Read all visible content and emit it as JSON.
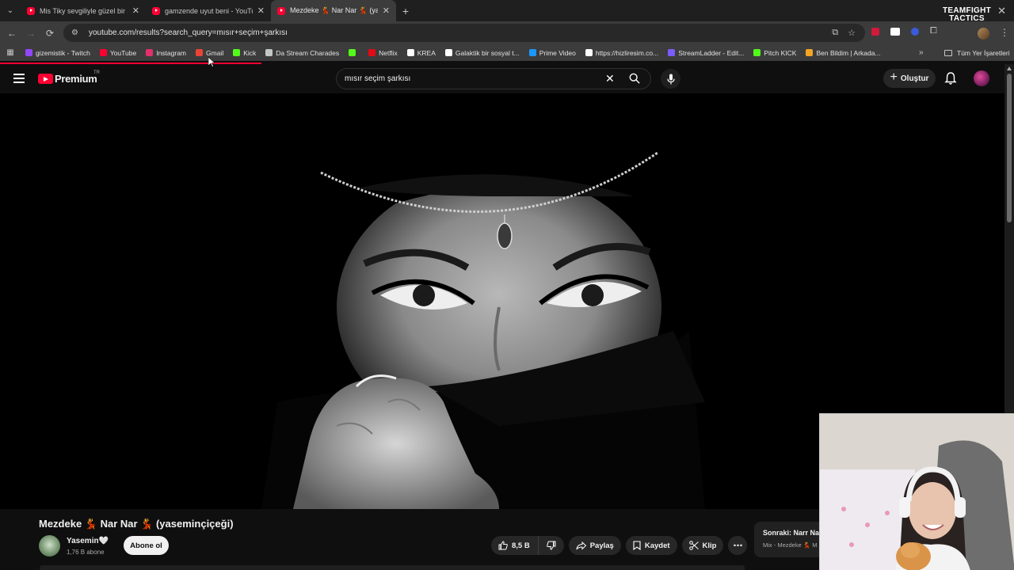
{
  "browser": {
    "tabs": [
      {
        "title": "Mis Tiky sevgiliyle güzel bir ara",
        "active": false
      },
      {
        "title": "gamzende uyut beni - YouTube",
        "active": false
      },
      {
        "title": "Mezdeke 💃 Nar Nar 💃 (yase",
        "active": true
      }
    ],
    "corner_logo": {
      "line1": "TEAMFIGHT",
      "line2": "TACTICS"
    },
    "url": "youtube.com/results?search_query=mısır+seçim+şarkısı",
    "bookmarks": [
      {
        "label": "gizemistik - Twitch",
        "icon": "twitch-icon",
        "color": "#9146ff"
      },
      {
        "label": "YouTube",
        "icon": "youtube-icon",
        "color": "#ff0033"
      },
      {
        "label": "Instagram",
        "icon": "instagram-icon",
        "color": "#e1306c"
      },
      {
        "label": "Gmail",
        "icon": "gmail-icon",
        "color": "#ea4335"
      },
      {
        "label": "Kick",
        "icon": "kick-icon",
        "color": "#53fc18"
      },
      {
        "label": "Da Stream Charades",
        "icon": "puzzle-icon",
        "color": "#c4c7c5"
      },
      {
        "label": "",
        "icon": "kick-icon",
        "color": "#53fc18"
      },
      {
        "label": "Netflix",
        "icon": "netflix-icon",
        "color": "#e50914"
      },
      {
        "label": "KREA",
        "icon": "krea-icon",
        "color": "#ffffff"
      },
      {
        "label": "Galaktik bir sosyal t...",
        "icon": "zk-icon",
        "color": "#ffffff"
      },
      {
        "label": "Prime Video",
        "icon": "prime-video-icon",
        "color": "#1a98ff"
      },
      {
        "label": "https://hizliresim.co...",
        "icon": "hizliresim-icon",
        "color": "#ffffff"
      },
      {
        "label": "StreamLadder - Edit...",
        "icon": "streamladder-icon",
        "color": "#7b5cff"
      },
      {
        "label": "Pitch KICK",
        "icon": "kick-icon",
        "color": "#53fc18"
      },
      {
        "label": "Ben Bildim | Arkada...",
        "icon": "benbildim-icon",
        "color": "#f4a623"
      }
    ],
    "all_bookmarks_label": "Tüm Yer İşaretleri"
  },
  "youtube": {
    "logo_text": "Premium",
    "logo_region": "TR",
    "search_value": "mısır seçim şarkısı",
    "create_label": "Oluştur",
    "video": {
      "title": "Mezdeke 💃 Nar Nar 💃 (yaseminçiçeği)",
      "channel": "Yasemin🤍",
      "subscribers": "1,76 B abone",
      "subscribe_label": "Abone ol",
      "likes": "8,5 B",
      "share_label": "Paylaş",
      "save_label": "Kaydet",
      "clip_label": "Klip"
    },
    "next_up": {
      "label": "Sonraki: Narr Narr",
      "sub": "Mix - Mezdeke 💃 M"
    }
  },
  "colors": {
    "accent": "#ff0033",
    "background": "#0f0f0f",
    "pill": "#272727"
  }
}
